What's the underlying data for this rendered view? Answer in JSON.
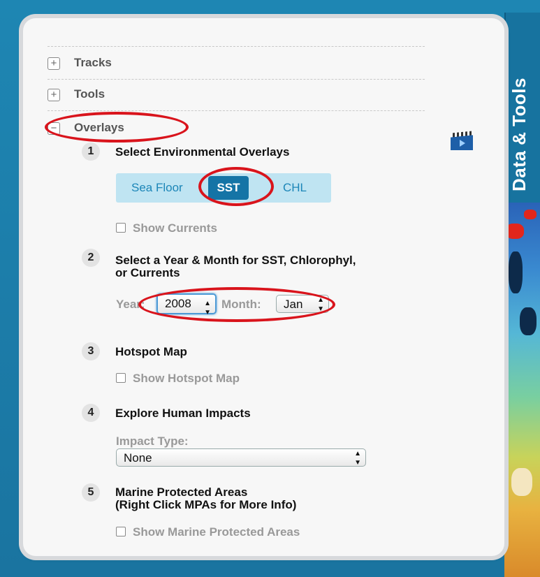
{
  "side_tab": {
    "label": "Data & Tools"
  },
  "sections": {
    "tracks": {
      "toggle": "+",
      "label": "Tracks"
    },
    "tools": {
      "toggle": "+",
      "label": "Tools"
    },
    "overlays": {
      "toggle": "−",
      "label": "Overlays"
    }
  },
  "steps": [
    {
      "number": "1",
      "title": "Select Environmental Overlays"
    },
    {
      "number": "2",
      "title_line1": "Select a Year & Month for SST, Chlorophyl,",
      "title_line2": "or Currents"
    },
    {
      "number": "3",
      "title": "Hotspot Map"
    },
    {
      "number": "4",
      "title": "Explore Human Impacts"
    },
    {
      "number": "5",
      "title_line1": "Marine Protected Areas",
      "title_line2": "(Right Click MPAs for More Info)"
    }
  ],
  "overlay_toggle": {
    "options": [
      "Sea Floor",
      "SST",
      "CHL"
    ],
    "selected": "SST"
  },
  "checkboxes": {
    "show_currents": "Show Currents",
    "show_hotspot_map": "Show Hotspot Map",
    "show_mpas": "Show Marine Protected Areas"
  },
  "date_select": {
    "year_label": "Year:",
    "year_value": "2008",
    "month_label": "Month:",
    "month_value": "Jan"
  },
  "impact": {
    "label": "Impact Type:",
    "value": "None"
  },
  "icons": {
    "video": "video-clip-icon"
  },
  "colors": {
    "accent": "#1574a6",
    "annotation": "#d9141c",
    "segment_bg": "#bfe4f2"
  }
}
